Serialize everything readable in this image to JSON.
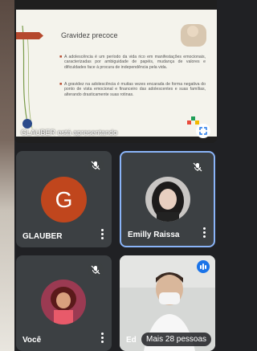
{
  "presentation": {
    "slide_title": "Gravidez precoce",
    "bullet1": "A adolescência é um período da vida rico em manifestações emocionais, caracterizadas por ambiguidade de papéis, mudança de valores e dificuldades face à procura de independência pela vida.",
    "bullet2": "A gravidez na adolescência é muitas vezes encarada de forma negativa do ponto de vista emocional e financeiro das adolescentes e suas famílias, alterando drasticamente suas rotinas.",
    "presenter_label": "GLAUBER está apresentando"
  },
  "tiles": {
    "glauber": {
      "name": "GLAUBER",
      "initial": "G",
      "avatar_color": "#c0461d"
    },
    "emilly": {
      "name": "Emilly Raissa"
    },
    "voce": {
      "name": "Você"
    },
    "ed": {
      "name": "Ed"
    }
  },
  "more_people": "Mais 28 pessoas",
  "icons": [
    "mic-off-icon",
    "more-vert-icon",
    "speaking-icon",
    "expand-icon"
  ]
}
